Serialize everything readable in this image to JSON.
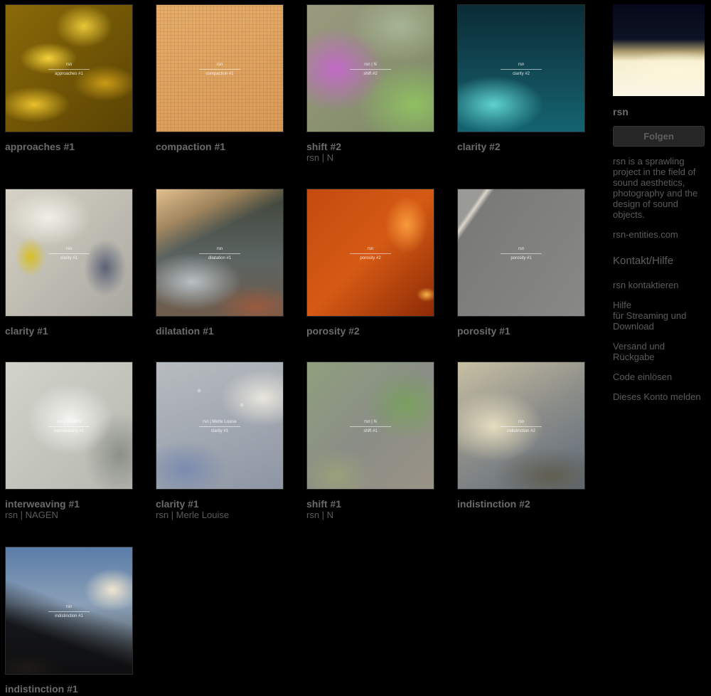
{
  "albums": [
    {
      "title": "approaches #1",
      "artist": "",
      "cover_artist": "rsn",
      "cover_title": "approaches #1"
    },
    {
      "title": "compaction #1",
      "artist": "",
      "cover_artist": "rsn",
      "cover_title": "compaction #1"
    },
    {
      "title": "shift #2",
      "artist": "rsn | N",
      "cover_artist": "rsn | N",
      "cover_title": "shift #2"
    },
    {
      "title": "clarity #2",
      "artist": "",
      "cover_artist": "rsn",
      "cover_title": "clarity #2"
    },
    {
      "title": "clarity #1",
      "artist": "",
      "cover_artist": "rsn",
      "cover_title": "clarity #1"
    },
    {
      "title": "dilatation #1",
      "artist": "",
      "cover_artist": "rsn",
      "cover_title": "dilatation #1"
    },
    {
      "title": "porosity #2",
      "artist": "",
      "cover_artist": "rsn",
      "cover_title": "porosity #2"
    },
    {
      "title": "porosity #1",
      "artist": "",
      "cover_artist": "rsn",
      "cover_title": "porosity #1"
    },
    {
      "title": "interweaving #1",
      "artist": "rsn | NAGEN",
      "cover_artist": "rsn | NAGEN",
      "cover_title": "interweaving #1"
    },
    {
      "title": "clarity #1",
      "artist": "rsn | Merle Louise",
      "cover_artist": "rsn | Merle Louise",
      "cover_title": "clarity #1"
    },
    {
      "title": "shift #1",
      "artist": "rsn | N",
      "cover_artist": "rsn | N",
      "cover_title": "shift #1"
    },
    {
      "title": "indistinction #2",
      "artist": "",
      "cover_artist": "rsn",
      "cover_title": "indistinction #2"
    },
    {
      "title": "indistinction #1",
      "artist": "",
      "cover_artist": "rsn",
      "cover_title": "indistinction #1"
    }
  ],
  "sidebar": {
    "band_name": "rsn",
    "follow_label": "Folgen",
    "bio": "rsn is a sprawling project in the field of sound aesthetics, photography and the design of sound objects.",
    "website": "rsn-entities.com",
    "contact_heading": "Kontakt/Hilfe",
    "links": {
      "contact": "rsn kontaktieren",
      "help_line1": "Hilfe",
      "help_line2": "für Streaming und Download",
      "shipping_line1": "Versand und",
      "shipping_line2": "Rückgabe",
      "redeem": "Code einlösen",
      "report": "Dieses Konto melden"
    }
  },
  "colors": {
    "background": "#000000",
    "text": "#6b6b6b",
    "button": "#262626"
  }
}
